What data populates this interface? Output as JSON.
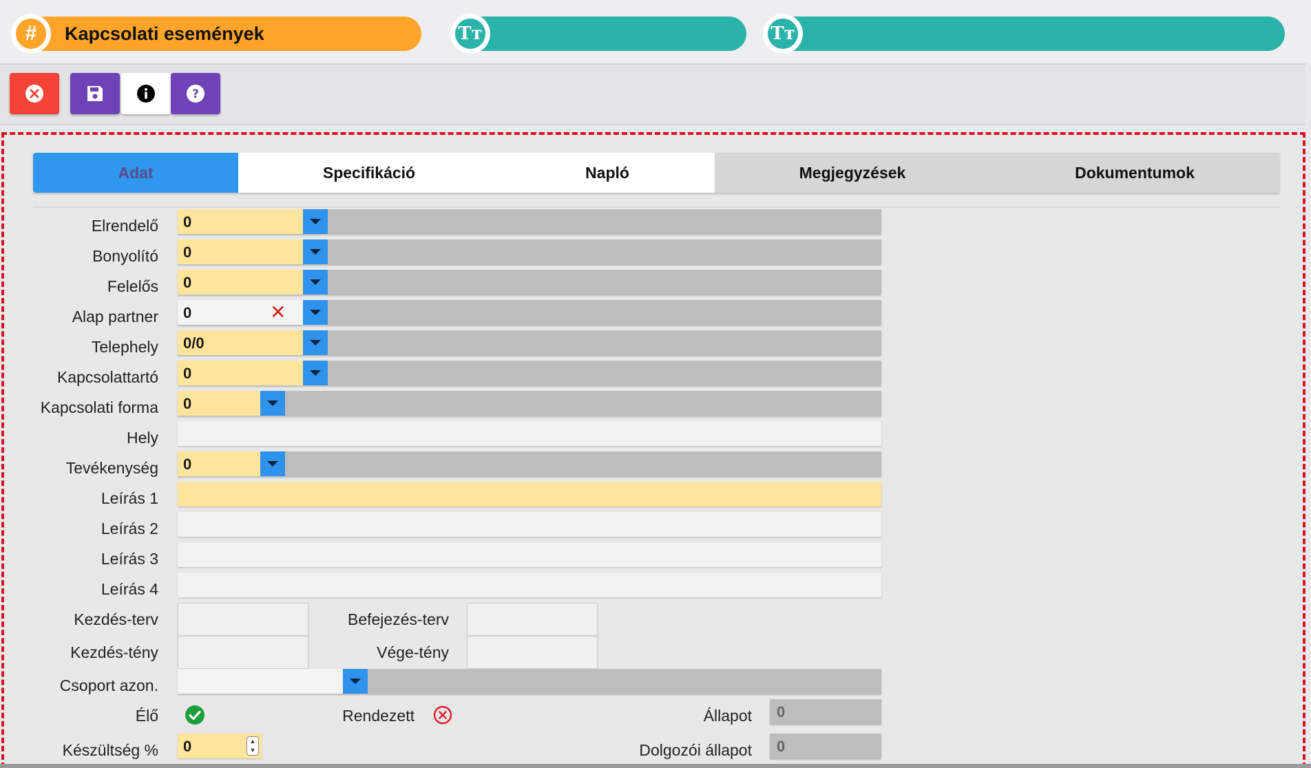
{
  "header": {
    "title": "Kapcsolati események",
    "title_icon": "hash-icon",
    "tile_icon": "text-size-icon",
    "hash_glyph": "#",
    "tile_glyph": "Tт"
  },
  "toolbar": {
    "close_icon": "close-circle-icon",
    "save_icon": "save-icon",
    "info_icon": "info-icon",
    "help_icon": "help-icon"
  },
  "tabs": [
    {
      "label": "Adat",
      "active": true
    },
    {
      "label": "Specifikáció"
    },
    {
      "label": "Napló"
    },
    {
      "label": "Megjegyzések"
    },
    {
      "label": "Dokumentumok"
    }
  ],
  "form": {
    "elrendelo": {
      "label": "Elrendelő",
      "value": "0"
    },
    "bonyolito": {
      "label": "Bonyolító",
      "value": "0"
    },
    "felelos": {
      "label": "Felelős",
      "value": "0"
    },
    "alap_partner": {
      "label": "Alap partner",
      "value": "0",
      "clear": "✕"
    },
    "telephely": {
      "label": "Telephely",
      "value": "0/0"
    },
    "kapcsolattarto": {
      "label": "Kapcsolattartó",
      "value": "0"
    },
    "kapcsolati_forma": {
      "label": "Kapcsolati forma",
      "value": "0"
    },
    "hely": {
      "label": "Hely",
      "value": ""
    },
    "tevekenyseg": {
      "label": "Tevékenység",
      "value": "0"
    },
    "leiras1": {
      "label": "Leírás 1",
      "value": ""
    },
    "leiras2": {
      "label": "Leírás 2",
      "value": ""
    },
    "leiras3": {
      "label": "Leírás 3",
      "value": ""
    },
    "leiras4": {
      "label": "Leírás 4",
      "value": ""
    },
    "kezdes_terv": {
      "label": "Kezdés-terv",
      "value": ""
    },
    "befejezes_terv": {
      "label": "Befejezés-terv",
      "value": ""
    },
    "kezdes_teny": {
      "label": "Kezdés-tény",
      "value": ""
    },
    "vege_teny": {
      "label": "Vége-tény",
      "value": ""
    },
    "csoport_azon": {
      "label": "Csoport azon.",
      "value": ""
    },
    "elo": {
      "label": "Élő",
      "checked": true
    },
    "rendezett": {
      "label": "Rendezett",
      "checked": false
    },
    "allapot": {
      "label": "Állapot",
      "value": "0"
    },
    "keszultseg": {
      "label": "Készültség %",
      "value": "0"
    },
    "dolgozoi_allapot": {
      "label": "Dolgozói állapot",
      "value": "0"
    }
  },
  "colors": {
    "title_orange": "#ffa42b",
    "teal": "#2ab3a9",
    "tab_active": "#2f97ef",
    "required_yellow": "#ffe49c",
    "panel_border": "#d9121f",
    "close_red": "#f44336",
    "purple": "#6f42b8"
  }
}
